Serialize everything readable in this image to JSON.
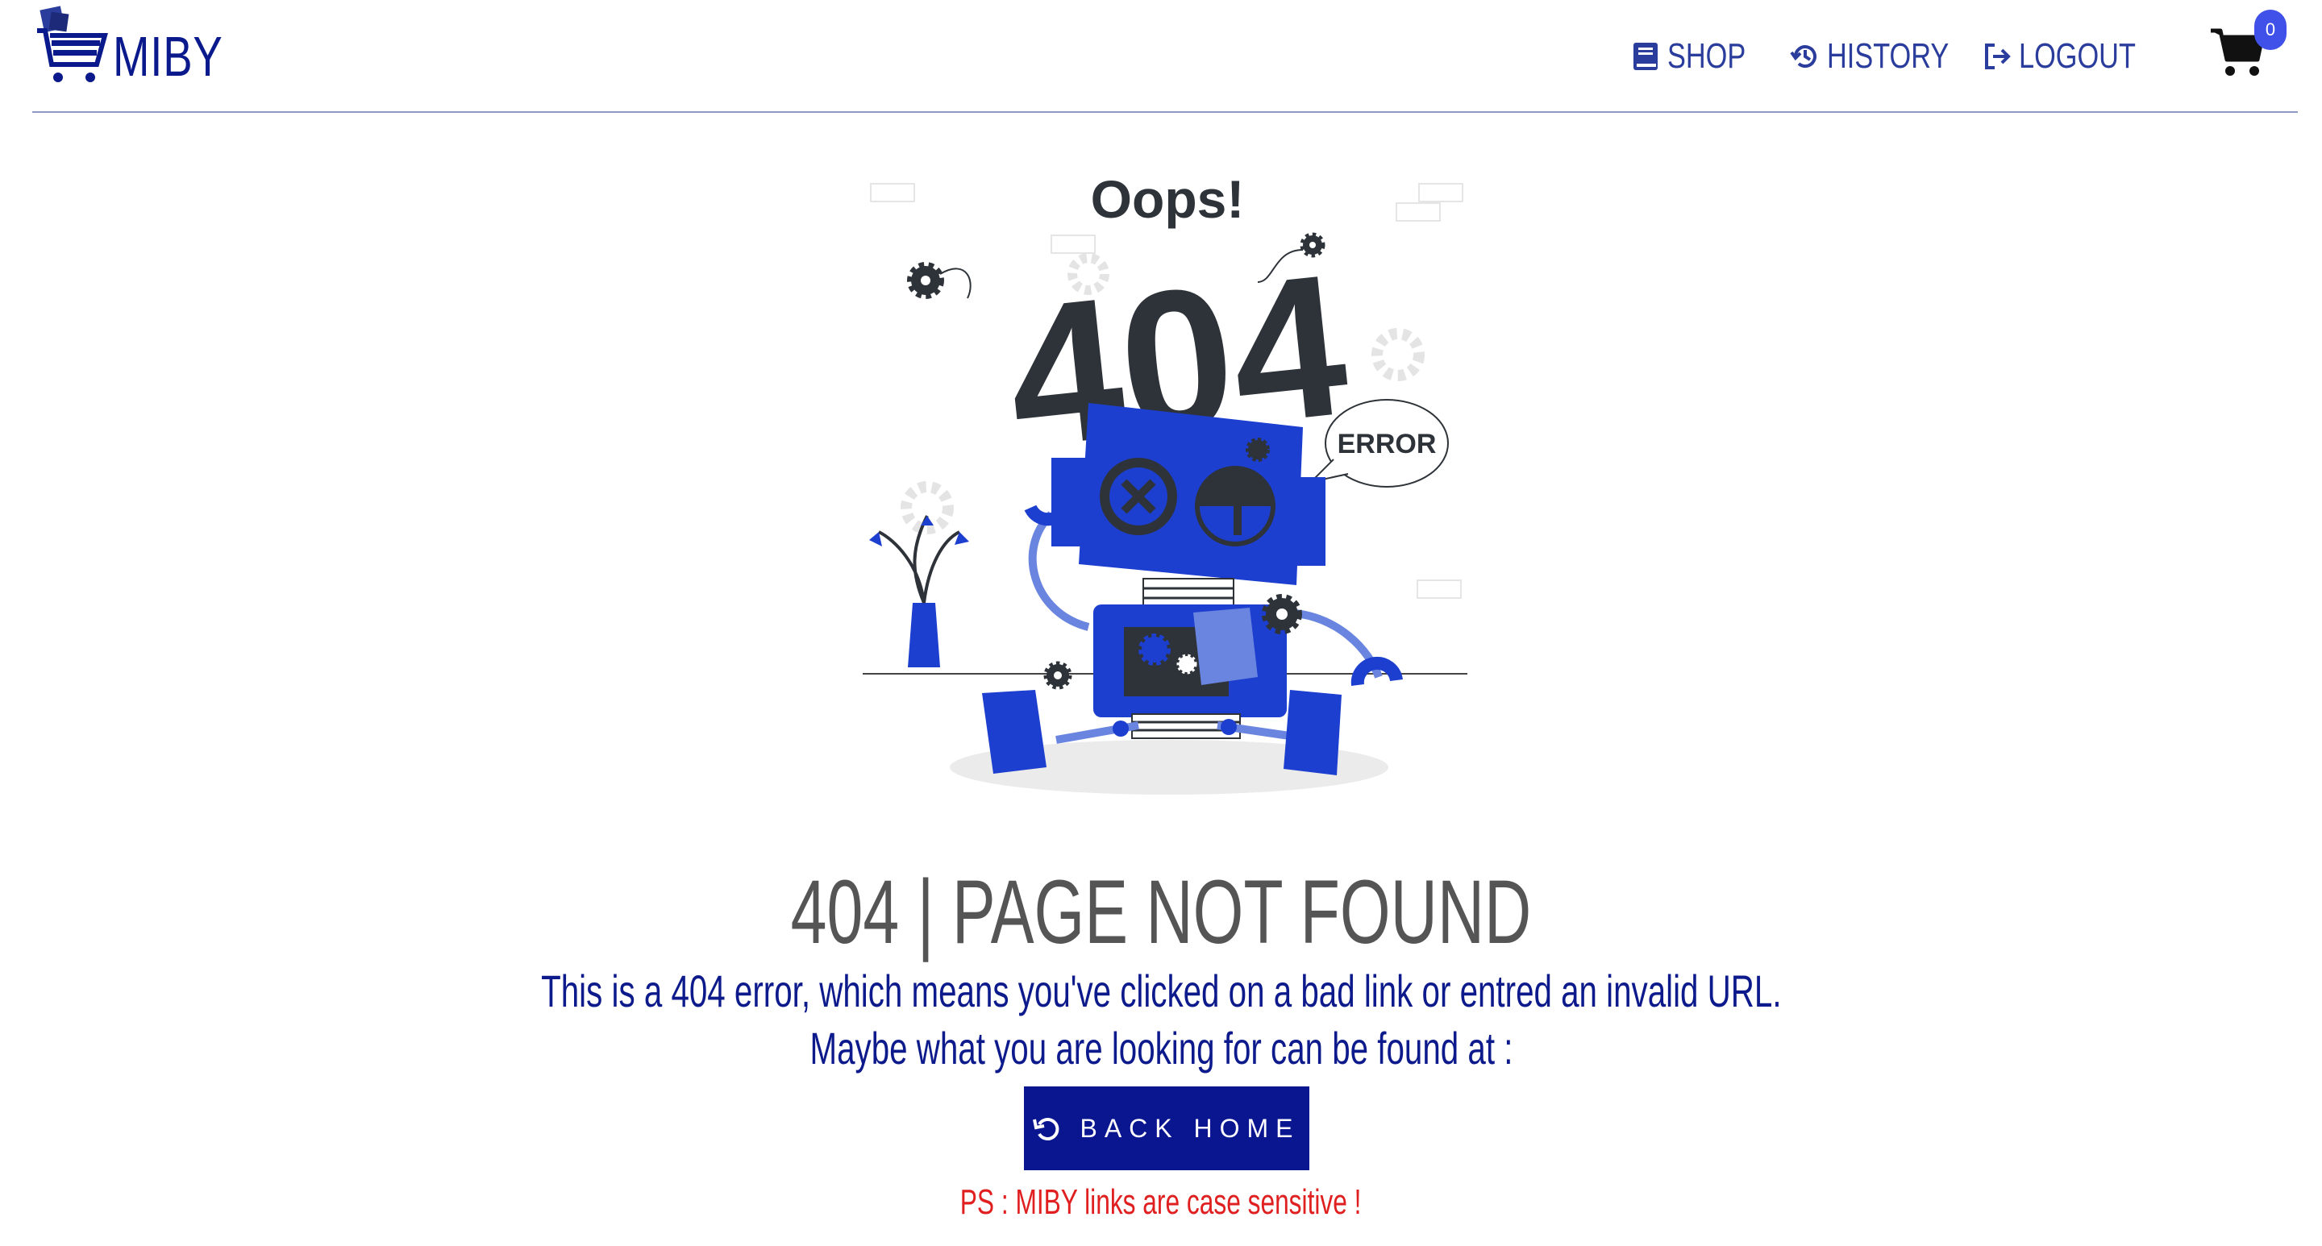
{
  "brand": {
    "name": "MIBY"
  },
  "nav": {
    "shop": "SHOP",
    "history": "HISTORY",
    "logout": "LOGOUT",
    "cart_count": "0"
  },
  "illustration": {
    "oops": "Oops!",
    "big_code": "404",
    "bubble": "ERROR"
  },
  "content": {
    "title": "404 | PAGE NOT FOUND",
    "line1": "This is a 404 error, which means you've clicked on a bad link or entred an invalid URL.",
    "line2": "Maybe what you are looking for can be found at :",
    "button_label": "BACK HOME",
    "ps": "PS : MIBY links are case sensitive !"
  },
  "colors": {
    "brand_blue": "#0a1a8c",
    "nav_blue": "#2b3d9c",
    "button_bg": "#0a1690",
    "robot_blue": "#1d3fcf",
    "ps_red": "#e02020",
    "badge": "#3f51e8"
  }
}
